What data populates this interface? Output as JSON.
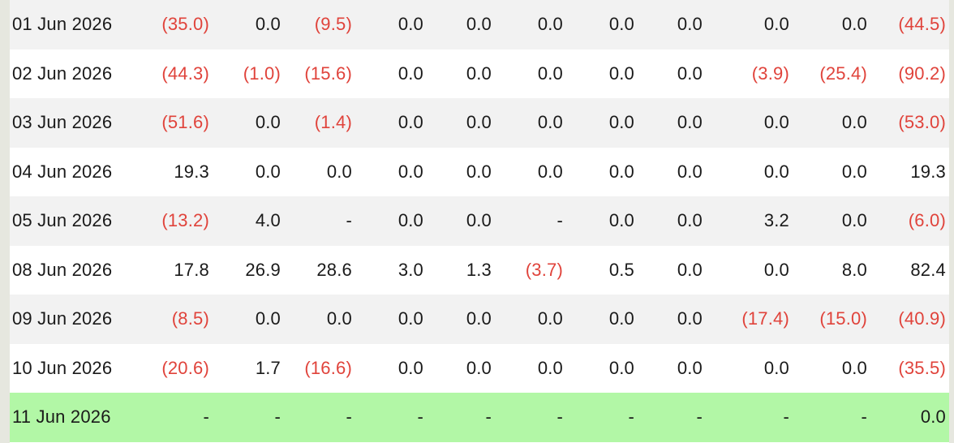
{
  "colors": {
    "negative": "#e0433b",
    "positive": "#1a1a1a",
    "row_alt": "#f2f2f2",
    "row_plain": "#ffffff",
    "row_highlight": "#b2f7a6"
  },
  "rows": [
    {
      "date": "01 Jun 2026",
      "style": "alt",
      "values": [
        "(35.0)",
        "0.0",
        "(9.5)",
        "0.0",
        "0.0",
        "0.0",
        "0.0",
        "0.0",
        "0.0",
        "0.0",
        "(44.5)"
      ]
    },
    {
      "date": "02 Jun 2026",
      "style": "plain",
      "values": [
        "(44.3)",
        "(1.0)",
        "(15.6)",
        "0.0",
        "0.0",
        "0.0",
        "0.0",
        "0.0",
        "(3.9)",
        "(25.4)",
        "(90.2)"
      ]
    },
    {
      "date": "03 Jun 2026",
      "style": "alt",
      "values": [
        "(51.6)",
        "0.0",
        "(1.4)",
        "0.0",
        "0.0",
        "0.0",
        "0.0",
        "0.0",
        "0.0",
        "0.0",
        "(53.0)"
      ]
    },
    {
      "date": "04 Jun 2026",
      "style": "plain",
      "values": [
        "19.3",
        "0.0",
        "0.0",
        "0.0",
        "0.0",
        "0.0",
        "0.0",
        "0.0",
        "0.0",
        "0.0",
        "19.3"
      ]
    },
    {
      "date": "05 Jun 2026",
      "style": "alt",
      "values": [
        "(13.2)",
        "4.0",
        "-",
        "0.0",
        "0.0",
        "-",
        "0.0",
        "0.0",
        "3.2",
        "0.0",
        "(6.0)"
      ]
    },
    {
      "date": "08 Jun 2026",
      "style": "plain",
      "values": [
        "17.8",
        "26.9",
        "28.6",
        "3.0",
        "1.3",
        "(3.7)",
        "0.5",
        "0.0",
        "0.0",
        "8.0",
        "82.4"
      ]
    },
    {
      "date": "09 Jun 2026",
      "style": "alt",
      "values": [
        "(8.5)",
        "0.0",
        "0.0",
        "0.0",
        "0.0",
        "0.0",
        "0.0",
        "0.0",
        "(17.4)",
        "(15.0)",
        "(40.9)"
      ]
    },
    {
      "date": "10 Jun 2026",
      "style": "plain",
      "values": [
        "(20.6)",
        "1.7",
        "(16.6)",
        "0.0",
        "0.0",
        "0.0",
        "0.0",
        "0.0",
        "0.0",
        "0.0",
        "(35.5)"
      ]
    },
    {
      "date": "11 Jun 2026",
      "style": "highlight",
      "values": [
        "-",
        "-",
        "-",
        "-",
        "-",
        "-",
        "-",
        "-",
        "-",
        "-",
        "0.0"
      ]
    }
  ]
}
